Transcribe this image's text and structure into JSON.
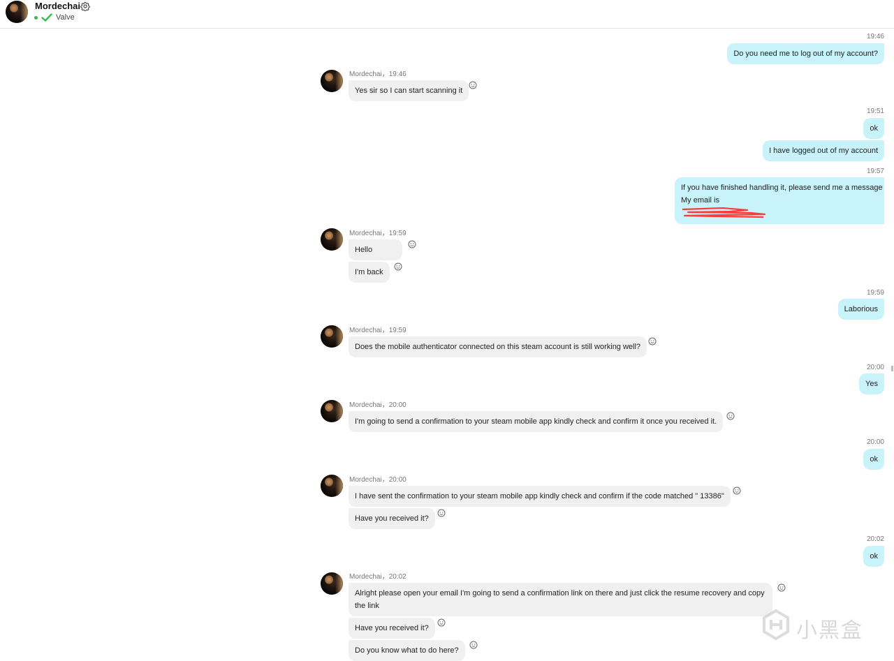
{
  "header": {
    "name": "Mordechai",
    "org": "Valve",
    "gear_icon": "gear-icon",
    "status_color": "#2fbf4f"
  },
  "messages": {
    "m1": {
      "time": "19:46",
      "text": "Do you need me to log out of my account?"
    },
    "m2": {
      "meta": "Mordechai，19:46",
      "text": "Yes sir so I can start scanning it"
    },
    "m3": {
      "time": "19:51",
      "text": "ok"
    },
    "m4": {
      "text": "I have logged out of my account"
    },
    "m5": {
      "time": "19:57",
      "line1": "If you have finished handling it, please send me a message",
      "line2": "My email is"
    },
    "m6": {
      "meta": "Mordechai，19:59",
      "text": "Hello"
    },
    "m7": {
      "text": "I'm back"
    },
    "m8": {
      "time": "19:59",
      "text": "Laborious"
    },
    "m9": {
      "meta": "Mordechai，19:59",
      "text": "Does the mobile authenticator connected on this steam account is still working well?"
    },
    "m10": {
      "time": "20:00",
      "text": "Yes"
    },
    "m11": {
      "meta": "Mordechai，20:00",
      "text": "I'm going to send a confirmation to your steam mobile app kindly check and confirm it once you received it."
    },
    "m12": {
      "time": "20:00",
      "text": "ok"
    },
    "m13": {
      "meta": "Mordechai，20:00",
      "text": "I have sent the confirmation to your steam mobile app kindly check and confirm if the code matched \" 13386\""
    },
    "m14": {
      "text": "Have you received it?"
    },
    "m15": {
      "time": "20:02",
      "text": "ok"
    },
    "m16": {
      "meta": "Mordechai，20:02",
      "text": "Alright please open your email I'm going to send a confirmation link on there and just click the resume recovery and copy the link"
    },
    "m17": {
      "text": "Have you received it?"
    },
    "m18": {
      "text": "Do you know what to do here?"
    }
  },
  "watermark": {
    "text": "小黑盒"
  },
  "colors": {
    "outgoing_bg": "#c9f3fb",
    "incoming_bg": "#f0f0f0",
    "redaction": "#ff3b3b"
  }
}
